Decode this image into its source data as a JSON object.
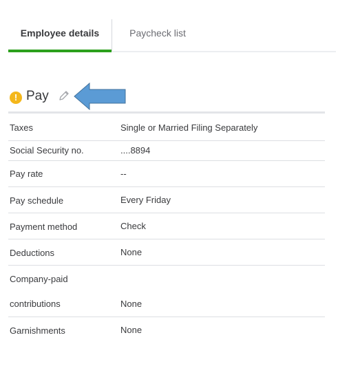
{
  "tabs": [
    {
      "label": "Employee details",
      "active": true
    },
    {
      "label": "Paycheck list",
      "active": false
    }
  ],
  "section": {
    "title": "Pay",
    "status_icon": "warning-icon",
    "edit_icon": "pencil-icon",
    "annotation_icon": "blue-arrow-icon"
  },
  "rows": [
    {
      "label": "Taxes",
      "value": "Single or Married Filing Separately"
    },
    {
      "label": "Social Security no.",
      "value": "....8894"
    },
    {
      "label": "Pay rate",
      "value": "--"
    },
    {
      "label": "Pay schedule",
      "value": "Every Friday"
    },
    {
      "label": "Payment method",
      "value": "Check"
    },
    {
      "label": "Deductions",
      "value": "None"
    },
    {
      "label_line1": "Company-paid",
      "label_line2": "contributions",
      "value": "None"
    },
    {
      "label": "Garnishments",
      "value": "None"
    }
  ],
  "colors": {
    "accent": "#2ca01c",
    "warning": "#f4b71b",
    "arrow": "#5b9bd5"
  }
}
